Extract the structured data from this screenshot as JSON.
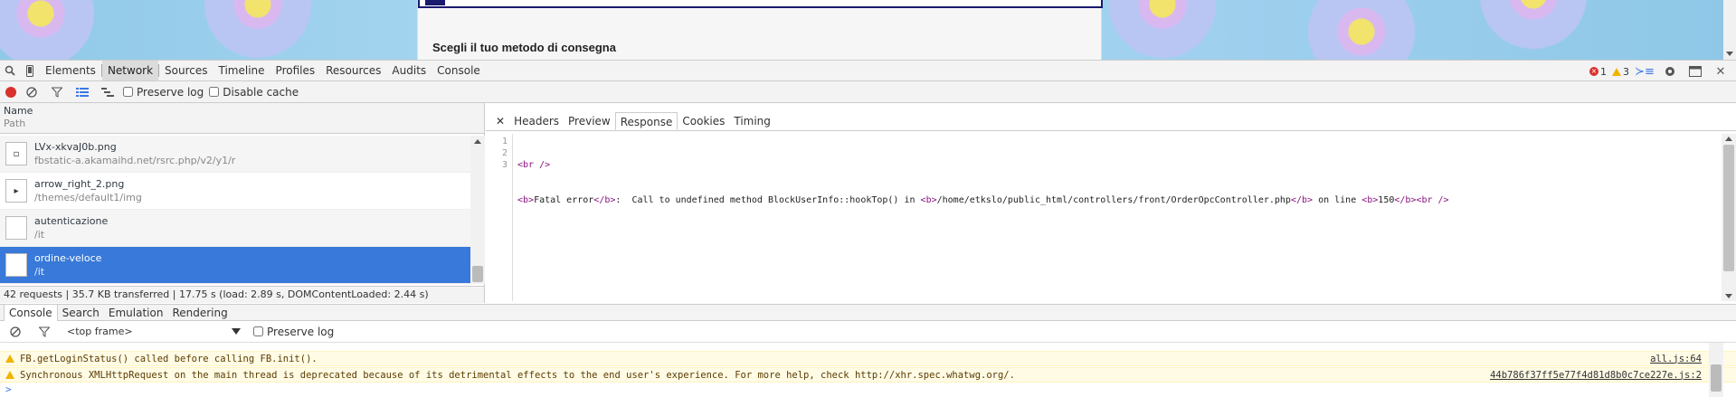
{
  "page": {
    "heading": "Scegli il tuo metodo di consegna"
  },
  "devtools": {
    "tabs": [
      "Elements",
      "Network",
      "Sources",
      "Timeline",
      "Profiles",
      "Resources",
      "Audits",
      "Console"
    ],
    "active_tab": "Network",
    "error_count": "1",
    "warning_count": "3"
  },
  "network_toolbar": {
    "preserve_log": "Preserve log",
    "disable_cache": "Disable cache"
  },
  "list_header": {
    "name": "Name",
    "path": "Path"
  },
  "requests": [
    {
      "name": "LVx-xkvaJ0b.png",
      "path": "fbstatic-a.akamaihd.net/rsrc.php/v2/y1/r"
    },
    {
      "name": "arrow_right_2.png",
      "path": "/themes/default1/img"
    },
    {
      "name": "autenticazione",
      "path": "/it"
    },
    {
      "name": "ordine-veloce",
      "path": "/it"
    }
  ],
  "status_bar": "42 requests | 35.7 KB transferred | 17.75 s (load: 2.89 s, DOMContentLoaded: 2.44 s)",
  "detail_tabs": [
    "Headers",
    "Preview",
    "Response",
    "Cookies",
    "Timing"
  ],
  "active_detail_tab": "Response",
  "response": {
    "line_numbers": [
      "1",
      "2",
      "3"
    ],
    "line1": "<br />",
    "line2_parts": {
      "b_open": "<b>",
      "fatal": "Fatal error",
      "b_close": "</b>",
      "msg": ":  Call to undefined method BlockUserInfo::hookTop() in ",
      "path": "/home/etkslo/public_html/controllers/front/OrderOpcController.php",
      "on_line": " on line ",
      "line_no": "150",
      "br": "<br />"
    }
  },
  "drawer": {
    "tabs": [
      "Console",
      "Search",
      "Emulation",
      "Rendering"
    ],
    "active_tab": "Console",
    "frame": "<top frame>",
    "preserve_log": "Preserve log"
  },
  "console_messages": [
    {
      "text": "FB.getLoginStatus() called before calling FB.init().",
      "source": "all.js:64"
    },
    {
      "text": "Synchronous XMLHttpRequest on the main thread is deprecated because of its detrimental effects to the end user's experience. For more help, check http://xhr.spec.whatwg.org/.",
      "source": "44b786f37ff5e77f4d81d8b0c7ce227e.js:2"
    }
  ],
  "prompt_symbol": ">",
  "colors": {
    "selected_row": "#3879d9",
    "tag_purple": "#881280",
    "warning_bg": "#fffbe5",
    "record_red": "#d9302c"
  }
}
